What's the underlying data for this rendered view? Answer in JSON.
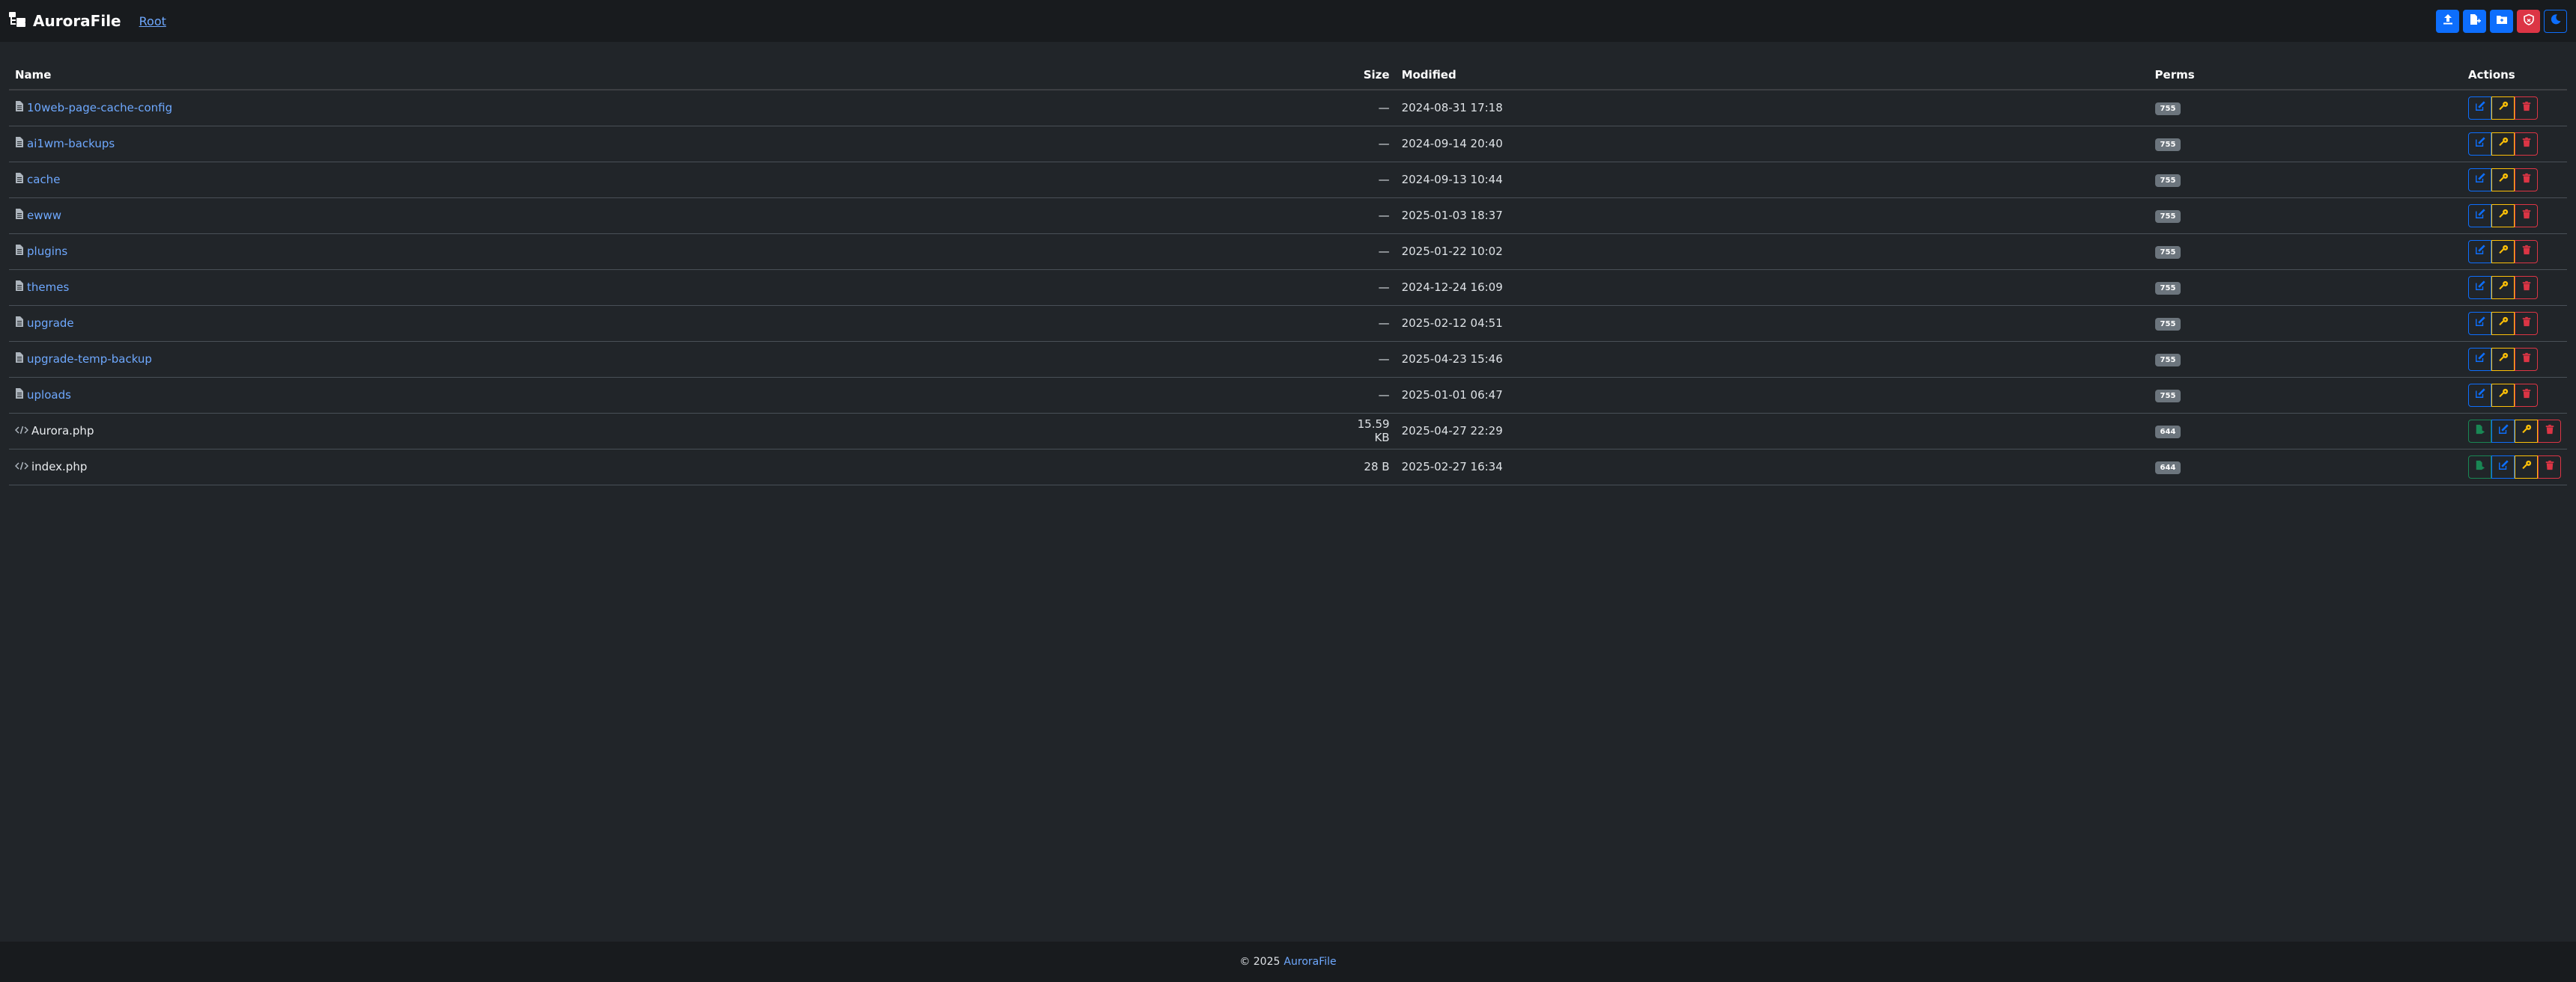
{
  "app": {
    "brand": "AuroraFile",
    "root_link": "Root"
  },
  "toolbar": {
    "buttons": [
      {
        "icon": "upload-icon",
        "style": "primary"
      },
      {
        "icon": "new-file-icon",
        "style": "primary"
      },
      {
        "icon": "new-folder-icon",
        "style": "primary"
      },
      {
        "icon": "shield-icon",
        "style": "danger"
      },
      {
        "icon": "moon-icon",
        "style": "outline-primary"
      }
    ]
  },
  "table": {
    "headers": {
      "name": "Name",
      "size": "Size",
      "modified": "Modified",
      "perms": "Perms",
      "actions": "Actions"
    },
    "rows": [
      {
        "type": "dir",
        "name": "10web-page-cache-config",
        "size": "—",
        "modified": "2024-08-31 17:18",
        "perms": "755"
      },
      {
        "type": "dir",
        "name": "ai1wm-backups",
        "size": "—",
        "modified": "2024-09-14 20:40",
        "perms": "755"
      },
      {
        "type": "dir",
        "name": "cache",
        "size": "—",
        "modified": "2024-09-13 10:44",
        "perms": "755"
      },
      {
        "type": "dir",
        "name": "ewww",
        "size": "—",
        "modified": "2025-01-03 18:37",
        "perms": "755"
      },
      {
        "type": "dir",
        "name": "plugins",
        "size": "—",
        "modified": "2025-01-22 10:02",
        "perms": "755"
      },
      {
        "type": "dir",
        "name": "themes",
        "size": "—",
        "modified": "2024-12-24 16:09",
        "perms": "755"
      },
      {
        "type": "dir",
        "name": "upgrade",
        "size": "—",
        "modified": "2025-02-12 04:51",
        "perms": "755"
      },
      {
        "type": "dir",
        "name": "upgrade-temp-backup",
        "size": "—",
        "modified": "2025-04-23 15:46",
        "perms": "755"
      },
      {
        "type": "dir",
        "name": "uploads",
        "size": "—",
        "modified": "2025-01-01 06:47",
        "perms": "755"
      },
      {
        "type": "file",
        "name": "Aurora.php",
        "size": "15.59 KB",
        "modified": "2025-04-27 22:29",
        "perms": "644"
      },
      {
        "type": "file",
        "name": "index.php",
        "size": "28 B",
        "modified": "2025-02-27 16:34",
        "perms": "644"
      }
    ]
  },
  "footer": {
    "copyright": "© 2025",
    "brand": "AuroraFile"
  },
  "colors": {
    "bg": "#212529",
    "navbar": "#181b1e",
    "link": "#6ea8fe",
    "primary": "#0d6efd",
    "warning": "#ffc107",
    "danger": "#dc3545",
    "success": "#198754",
    "badge": "#6c757d"
  }
}
